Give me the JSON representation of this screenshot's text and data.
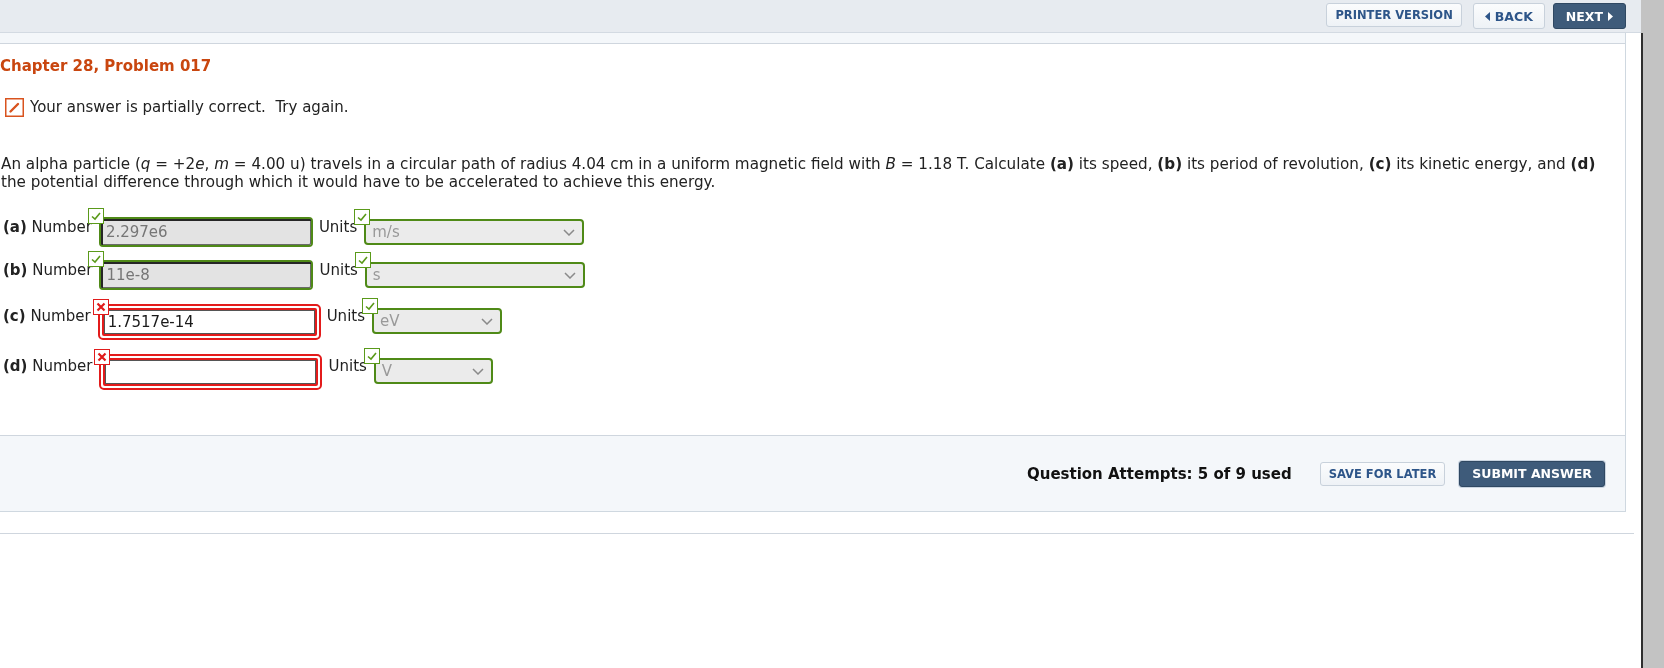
{
  "toolbar": {
    "buttons": [
      {
        "label": "PRINTER VERSION",
        "kind": "plain"
      },
      {
        "label": "BACK",
        "kind": "back"
      },
      {
        "label": "NEXT",
        "kind": "next"
      }
    ]
  },
  "problem": {
    "title": "Chapter 28, Problem 017",
    "feedback": {
      "kind": "partial",
      "text": "Your answer is partially correct.  Try again."
    },
    "question": [
      "An alpha particle (*q* = +2",
      "*e*, *m* = 4.00 u) travels in a circular path of radius 4.04 cm in a uniform magnetic field with *B* = 1.18 T. Calculate **(a)** its speed, **(b)** its period of revolution, **(c)** its kinetic energy, and **(d)** the potential difference through which it would have to be accelerated to achieve this energy."
    ]
  },
  "answers": [
    {
      "label": "**(a)** Number",
      "number": {
        "value": "2.297e6",
        "correct": true,
        "disabled": true
      },
      "units_label": "Units",
      "units": {
        "value": "m/s",
        "correct": true,
        "disabled": true
      }
    },
    {
      "label": "**(b)** Number",
      "number": {
        "value": "11e-8",
        "correct": true,
        "disabled": true
      },
      "units_label": "Units",
      "units": {
        "value": "s",
        "correct": true,
        "disabled": true
      }
    },
    {
      "label": "**(c)** Number",
      "number": {
        "value": "1.7517e-14",
        "correct": false,
        "disabled": false
      },
      "units_label": "Units",
      "units": {
        "value": "eV",
        "correct": true,
        "disabled": true
      }
    },
    {
      "label": "**(d)** Number",
      "number": {
        "correct": false,
        "disabled": false
      },
      "units_label": "Units",
      "units": {
        "value": "V",
        "correct": true,
        "disabled": true
      }
    }
  ],
  "footer": {
    "attempts": "Question Attempts: 5 of 9 used",
    "buttons": [
      {
        "label": "SAVE FOR LATER",
        "kind": "secondary"
      },
      {
        "label": "SUBMIT ANSWER",
        "kind": "primary"
      }
    ]
  }
}
